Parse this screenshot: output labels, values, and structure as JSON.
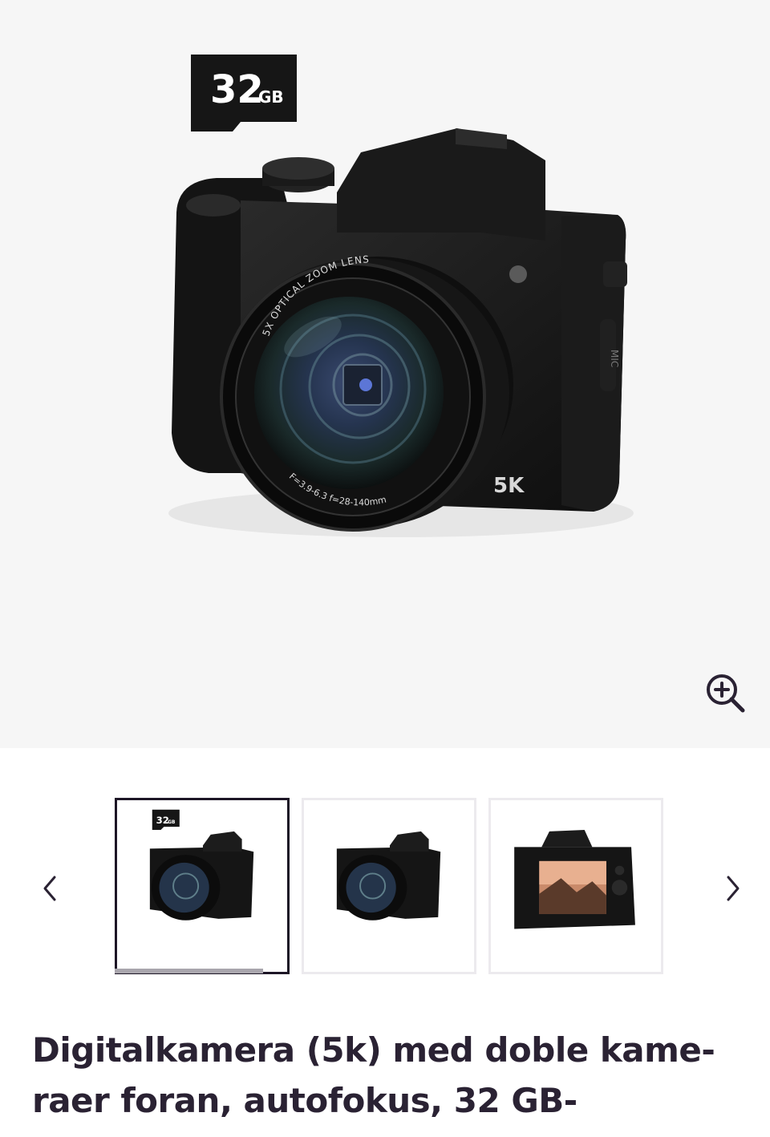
{
  "product_image": {
    "memory_card_label": "32",
    "memory_card_unit": "GB",
    "lens_top_text": "5X OPTICAL ZOOM LENS",
    "lens_bottom_text": "F=3.9-6.3  f=28-140mm",
    "body_badge": "5K",
    "mic_label": "MIC"
  },
  "zoom_button_icon": "zoom-in-icon",
  "gallery": {
    "prev_icon": "chevron-left-icon",
    "next_icon": "chevron-right-icon",
    "thumbnails": [
      {
        "label": "32",
        "unit": "GB",
        "active": true
      },
      {
        "active": false
      },
      {
        "active": false
      }
    ],
    "progress": 0.85
  },
  "product": {
    "title": "Digitalkamera (5k) med doble kame-raer foran, autofokus, 32 GB-"
  },
  "colors": {
    "hero_bg": "#f6f6f6",
    "text": "#2a2233",
    "active_border": "#1d1626"
  }
}
